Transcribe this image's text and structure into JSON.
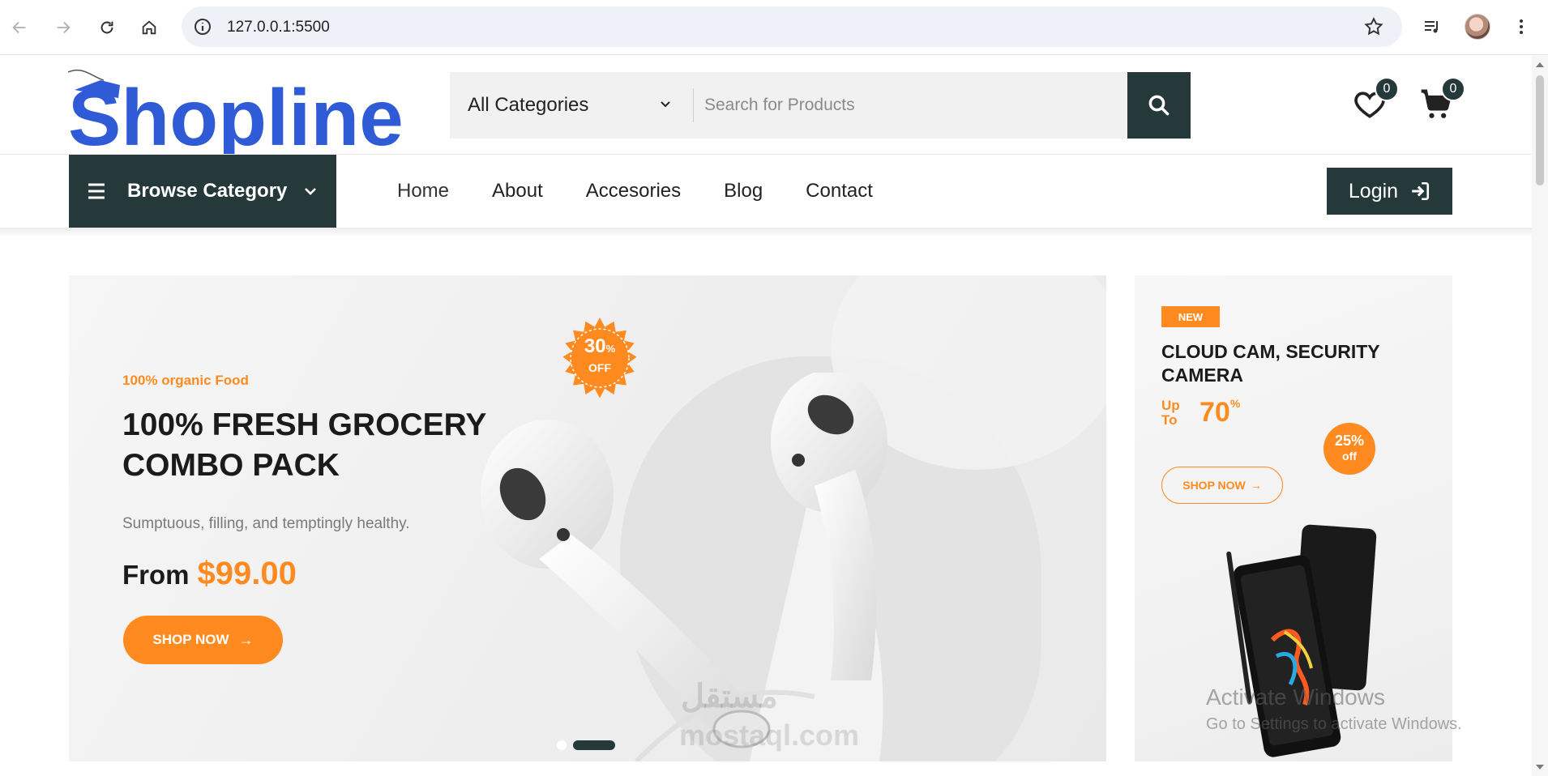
{
  "browser": {
    "url": "127.0.0.1:5500"
  },
  "header": {
    "logo_text": "Shopline",
    "category_select": "All Categories",
    "search_placeholder": "Search for Products",
    "wishlist_count": "0",
    "cart_count": "0"
  },
  "nav": {
    "browse_label": "Browse Category",
    "links": [
      "Home",
      "About",
      "Accesories",
      "Blog",
      "Contact"
    ],
    "login_label": "Login"
  },
  "hero": {
    "tag": "100% organic Food",
    "title": "100% FRESH GROCERY COMBO PACK",
    "subtitle": "Sumptuous, filling, and temptingly healthy.",
    "price_prefix": "From",
    "price": "$99.00",
    "button": "SHOP NOW",
    "seal_value": "30",
    "seal_percent": "%",
    "seal_off": "OFF",
    "slides_total": 2,
    "slide_active": 2
  },
  "promo": {
    "badge": "NEW",
    "title": "CLOUD CAM, SECURITY CAMERA",
    "up_to": "Up To",
    "discount": "70",
    "discount_unit": "%",
    "circle_value": "25%",
    "circle_label": "off",
    "button": "SHOP NOW"
  },
  "overlays": {
    "watermark_ar": "مستقل",
    "watermark_en": "mostaql.com",
    "activate_title": "Activate Windows",
    "activate_sub": "Go to Settings to activate Windows."
  },
  "colors": {
    "primary_dark": "#26393a",
    "accent_orange": "#ff8a1f",
    "logo_blue": "#2f5bd6"
  }
}
